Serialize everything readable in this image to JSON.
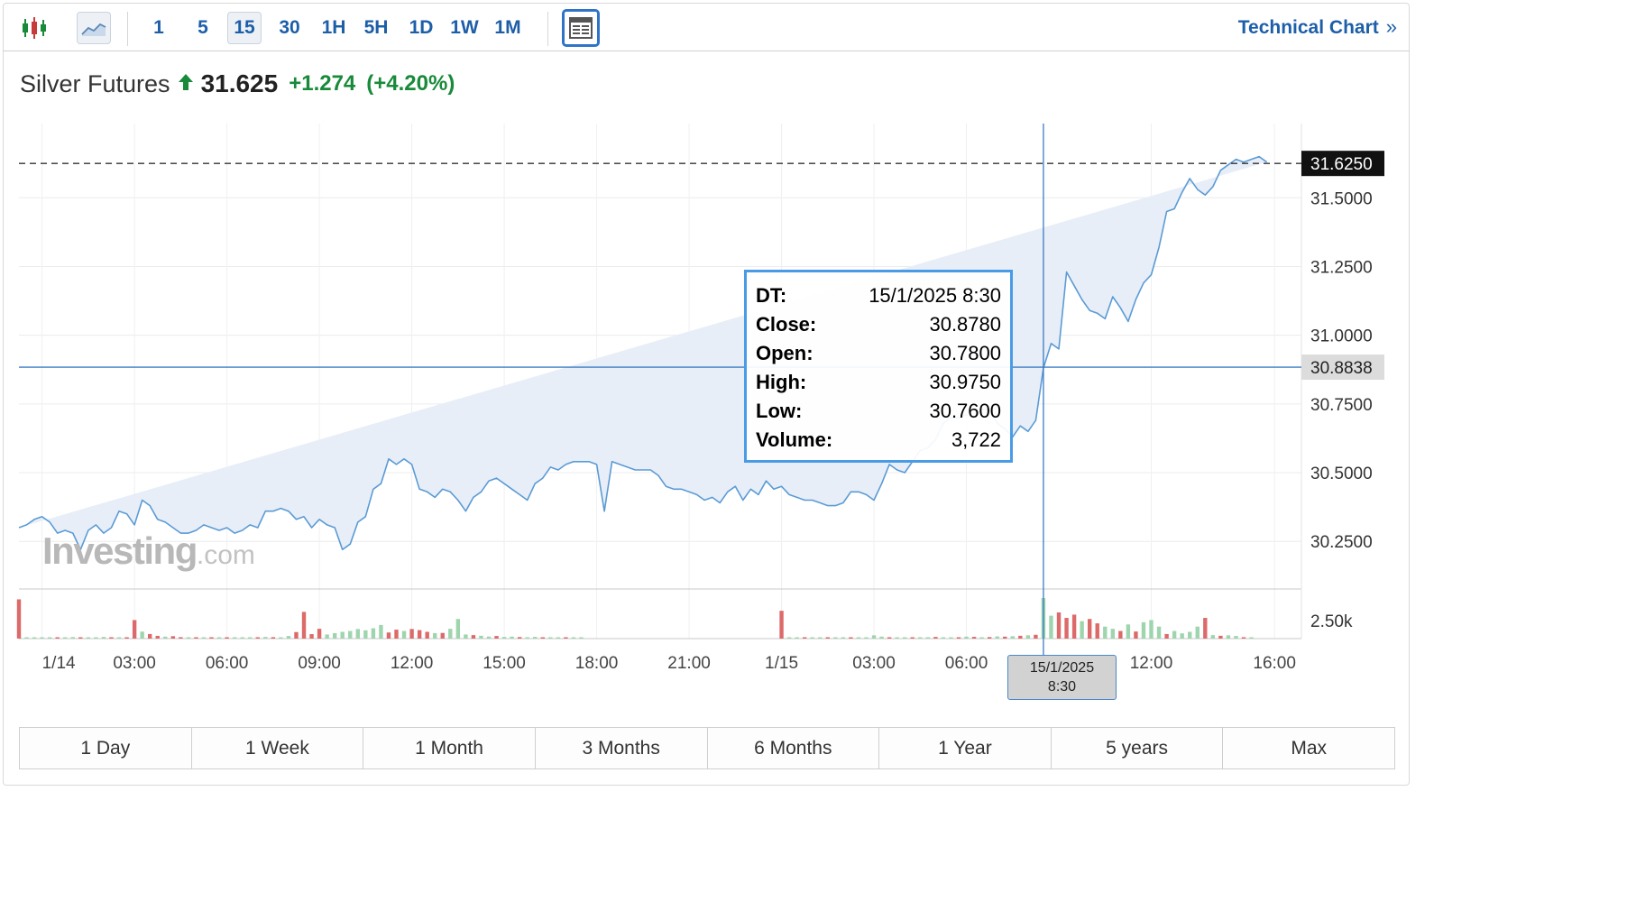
{
  "toolbar": {
    "chart_type_icons": [
      "candlestick-icon",
      "area-chart-icon"
    ],
    "intervals": [
      "1",
      "5",
      "15",
      "30",
      "1H",
      "5H",
      "1D",
      "1W",
      "1M"
    ],
    "selected_interval": "15",
    "layout_icon": "layout-icon",
    "technical_link": "Technical Chart",
    "technical_link_icon": "double-chevron-right-icon"
  },
  "headline": {
    "name": "Silver Futures",
    "price": "31.625",
    "change": "+1.274",
    "change_pct": "(+4.20%)",
    "direction_icon": "arrow-up-icon"
  },
  "colors": {
    "accent": "#1d5ea9",
    "up": "#188a3a",
    "line": "#5b9bd5",
    "area": "#e8eef7",
    "crosshair": "#3a7cc4",
    "volume_up": "#9fd5ae",
    "volume_down": "#dd6a6a",
    "tooltip_border": "#4a9be6"
  },
  "watermark": {
    "brand": "Investing",
    "suffix": ".com"
  },
  "tooltip": [
    {
      "key": "DT:",
      "value": "15/1/2025 8:30"
    },
    {
      "key": "Close:",
      "value": "30.8780"
    },
    {
      "key": "Open:",
      "value": "30.7800"
    },
    {
      "key": "High:",
      "value": "30.9750"
    },
    {
      "key": "Low:",
      "value": "30.7600"
    },
    {
      "key": "Volume:",
      "value": "3,722"
    }
  ],
  "time_flag": {
    "line1": "15/1/2025",
    "line2": "8:30"
  },
  "range_buttons": [
    "1 Day",
    "1 Week",
    "1 Month",
    "3 Months",
    "6 Months",
    "1 Year",
    "5 years",
    "Max"
  ],
  "chart_data": {
    "type": "area",
    "title": "Silver Futures",
    "xlabel": "",
    "ylabel": "",
    "x_ticks": [
      "1/14",
      "03:00",
      "06:00",
      "09:00",
      "12:00",
      "15:00",
      "18:00",
      "21:00",
      "1/15",
      "03:00",
      "06:00",
      "12:00",
      "16:00"
    ],
    "x_ticks_hours": [
      0,
      3,
      6,
      9,
      12,
      15,
      18,
      21,
      24,
      27,
      30,
      36,
      40
    ],
    "y_ticks": [
      "30.2500",
      "30.5000",
      "30.7500",
      "31.0000",
      "31.2500",
      "31.5000"
    ],
    "y_ticks_values": [
      30.25,
      30.5,
      30.75,
      31.0,
      31.25,
      31.5
    ],
    "ylim": [
      30.08,
      31.77
    ],
    "xlim_hours": [
      -0.75,
      40.2
    ],
    "last_price_label": "31.6250",
    "last_price": 31.625,
    "crosshair_label": "30.8838",
    "crosshair_price": 30.8838,
    "crosshair_hour": 32.5,
    "volume_tick_label": "2.50k",
    "volume_tick_value": 2500,
    "grid": true,
    "series": [
      {
        "x": [
          -0.75,
          -0.5,
          -0.25,
          0.0,
          0.25,
          0.5,
          0.75,
          1.0,
          1.25,
          1.5,
          1.75,
          2.0,
          2.25,
          2.5,
          2.75,
          3.0,
          3.25,
          3.5,
          3.75,
          4.0,
          4.25,
          4.5,
          4.75,
          5.0,
          5.25,
          5.5,
          5.75,
          6.0,
          6.25,
          6.5,
          6.75,
          7.0,
          7.25,
          7.5,
          7.75,
          8.0,
          8.25,
          8.5,
          8.75,
          9.0,
          9.25,
          9.5,
          9.75,
          10.0,
          10.25,
          10.5,
          10.75,
          11.0,
          11.25,
          11.5,
          11.75,
          12.0,
          12.25,
          12.5,
          12.75,
          13.0,
          13.25,
          13.5,
          13.75,
          14.0,
          14.25,
          14.5,
          14.75,
          15.0,
          15.25,
          15.5,
          15.75,
          16.0,
          16.25,
          16.5,
          16.75,
          17.0,
          17.25,
          17.5,
          17.75,
          18.0,
          18.25,
          18.5,
          18.75,
          19.0,
          19.25,
          19.5,
          19.75,
          20.0,
          20.25,
          20.5,
          20.75,
          21.0,
          21.25,
          21.5,
          21.75,
          22.0,
          22.25,
          22.5,
          22.75,
          23.0,
          23.25,
          23.5,
          23.75,
          24.0,
          24.25,
          24.5,
          24.75,
          25.0,
          25.25,
          25.5,
          25.75,
          26.0,
          26.25,
          26.5,
          26.75,
          27.0,
          27.25,
          27.5,
          27.75,
          28.0,
          28.25,
          28.5,
          28.75,
          29.0,
          29.25,
          29.5,
          29.75,
          30.0,
          30.25,
          30.5,
          30.75,
          31.0,
          31.25,
          31.5,
          31.75,
          32.0,
          32.25,
          32.5,
          32.75,
          33.0,
          33.25,
          33.5,
          33.75,
          34.0,
          34.25,
          34.5,
          34.75,
          35.0,
          35.25,
          35.5,
          35.75,
          36.0,
          36.25,
          36.5,
          36.75,
          37.0,
          37.25,
          37.5,
          37.75,
          38.0,
          38.25,
          38.5,
          38.75,
          39.0,
          39.25,
          39.5,
          39.75,
          40.0
        ],
        "close": [
          30.3,
          30.31,
          30.33,
          30.34,
          30.32,
          30.28,
          30.29,
          30.28,
          30.22,
          30.29,
          30.31,
          30.28,
          30.3,
          30.36,
          30.35,
          30.31,
          30.4,
          30.38,
          30.33,
          30.32,
          30.3,
          30.28,
          30.28,
          30.29,
          30.31,
          30.3,
          30.29,
          30.3,
          30.28,
          30.29,
          30.31,
          30.3,
          30.36,
          30.36,
          30.37,
          30.36,
          30.33,
          30.34,
          30.3,
          30.33,
          30.31,
          30.3,
          30.22,
          30.24,
          30.32,
          30.34,
          30.44,
          30.46,
          30.55,
          30.53,
          30.55,
          30.53,
          30.44,
          30.43,
          30.41,
          30.44,
          30.43,
          30.4,
          30.36,
          30.41,
          30.43,
          30.47,
          30.48,
          30.46,
          30.44,
          30.42,
          30.4,
          30.46,
          30.48,
          30.52,
          30.51,
          30.53,
          30.54,
          30.54,
          30.54,
          30.53,
          30.36,
          30.54,
          30.53,
          30.52,
          30.51,
          30.51,
          30.51,
          30.49,
          30.45,
          30.44,
          30.44,
          30.43,
          30.42,
          30.4,
          30.41,
          30.39,
          30.43,
          30.45,
          30.4,
          30.44,
          30.42,
          30.47,
          30.44,
          30.45,
          30.42,
          30.41,
          30.4,
          30.4,
          30.39,
          30.38,
          30.38,
          30.39,
          30.43,
          30.43,
          30.42,
          30.4,
          30.46,
          30.53,
          30.51,
          30.5,
          30.54,
          30.58,
          30.59,
          30.62,
          30.68,
          30.7,
          30.7,
          30.71,
          30.7,
          30.73,
          30.73,
          30.68,
          30.66,
          30.63,
          30.67,
          30.65,
          30.69,
          30.88,
          30.97,
          30.95,
          31.23,
          31.18,
          31.13,
          31.09,
          31.08,
          31.06,
          31.14,
          31.1,
          31.05,
          31.13,
          31.19,
          31.22,
          31.32,
          31.45,
          31.46,
          31.52,
          31.57,
          31.53,
          31.51,
          31.54,
          31.6,
          31.62,
          31.64,
          31.63,
          31.64,
          31.65,
          31.63
        ]
      }
    ],
    "volume": [
      {
        "x": -0.75,
        "v": 3600,
        "dir": "down"
      },
      {
        "x": -0.5,
        "v": 100,
        "dir": "up"
      },
      {
        "x": -0.25,
        "v": 80,
        "dir": "up"
      },
      {
        "x": 0.0,
        "v": 120,
        "dir": "up"
      },
      {
        "x": 0.25,
        "v": 60,
        "dir": "up"
      },
      {
        "x": 0.5,
        "v": 90,
        "dir": "down"
      },
      {
        "x": 0.75,
        "v": 70,
        "dir": "up"
      },
      {
        "x": 1.0,
        "v": 140,
        "dir": "up"
      },
      {
        "x": 1.25,
        "v": 60,
        "dir": "down"
      },
      {
        "x": 1.5,
        "v": 120,
        "dir": "up"
      },
      {
        "x": 1.75,
        "v": 80,
        "dir": "up"
      },
      {
        "x": 2.0,
        "v": 150,
        "dir": "up"
      },
      {
        "x": 2.25,
        "v": 60,
        "dir": "down"
      },
      {
        "x": 2.5,
        "v": 90,
        "dir": "up"
      },
      {
        "x": 2.75,
        "v": 70,
        "dir": "down"
      },
      {
        "x": 3.0,
        "v": 1700,
        "dir": "down"
      },
      {
        "x": 3.25,
        "v": 640,
        "dir": "up"
      },
      {
        "x": 3.5,
        "v": 420,
        "dir": "down"
      },
      {
        "x": 3.75,
        "v": 250,
        "dir": "down"
      },
      {
        "x": 4.0,
        "v": 180,
        "dir": "up"
      },
      {
        "x": 4.25,
        "v": 220,
        "dir": "down"
      },
      {
        "x": 4.5,
        "v": 130,
        "dir": "down"
      },
      {
        "x": 4.75,
        "v": 90,
        "dir": "up"
      },
      {
        "x": 5.0,
        "v": 120,
        "dir": "down"
      },
      {
        "x": 5.25,
        "v": 90,
        "dir": "up"
      },
      {
        "x": 5.5,
        "v": 70,
        "dir": "down"
      },
      {
        "x": 5.75,
        "v": 100,
        "dir": "up"
      },
      {
        "x": 6.0,
        "v": 60,
        "dir": "down"
      },
      {
        "x": 6.25,
        "v": 90,
        "dir": "up"
      },
      {
        "x": 6.5,
        "v": 80,
        "dir": "up"
      },
      {
        "x": 6.75,
        "v": 120,
        "dir": "up"
      },
      {
        "x": 7.0,
        "v": 90,
        "dir": "down"
      },
      {
        "x": 7.25,
        "v": 150,
        "dir": "up"
      },
      {
        "x": 7.5,
        "v": 130,
        "dir": "down"
      },
      {
        "x": 7.75,
        "v": 110,
        "dir": "up"
      },
      {
        "x": 8.0,
        "v": 240,
        "dir": "up"
      },
      {
        "x": 8.25,
        "v": 600,
        "dir": "down"
      },
      {
        "x": 8.5,
        "v": 2450,
        "dir": "down"
      },
      {
        "x": 8.75,
        "v": 410,
        "dir": "down"
      },
      {
        "x": 9.0,
        "v": 900,
        "dir": "down"
      },
      {
        "x": 9.25,
        "v": 380,
        "dir": "up"
      },
      {
        "x": 9.5,
        "v": 500,
        "dir": "up"
      },
      {
        "x": 9.75,
        "v": 620,
        "dir": "up"
      },
      {
        "x": 10.0,
        "v": 700,
        "dir": "up"
      },
      {
        "x": 10.25,
        "v": 880,
        "dir": "up"
      },
      {
        "x": 10.5,
        "v": 760,
        "dir": "up"
      },
      {
        "x": 10.75,
        "v": 950,
        "dir": "up"
      },
      {
        "x": 11.0,
        "v": 1250,
        "dir": "up"
      },
      {
        "x": 11.25,
        "v": 560,
        "dir": "down"
      },
      {
        "x": 11.5,
        "v": 820,
        "dir": "down"
      },
      {
        "x": 11.75,
        "v": 700,
        "dir": "up"
      },
      {
        "x": 12.0,
        "v": 880,
        "dir": "down"
      },
      {
        "x": 12.25,
        "v": 780,
        "dir": "down"
      },
      {
        "x": 12.5,
        "v": 620,
        "dir": "down"
      },
      {
        "x": 12.75,
        "v": 500,
        "dir": "up"
      },
      {
        "x": 13.0,
        "v": 520,
        "dir": "down"
      },
      {
        "x": 13.25,
        "v": 900,
        "dir": "up"
      },
      {
        "x": 13.5,
        "v": 1800,
        "dir": "up"
      },
      {
        "x": 13.75,
        "v": 380,
        "dir": "up"
      },
      {
        "x": 14.0,
        "v": 320,
        "dir": "down"
      },
      {
        "x": 14.25,
        "v": 260,
        "dir": "up"
      },
      {
        "x": 14.5,
        "v": 190,
        "dir": "up"
      },
      {
        "x": 14.75,
        "v": 240,
        "dir": "down"
      },
      {
        "x": 15.0,
        "v": 150,
        "dir": "up"
      },
      {
        "x": 15.25,
        "v": 180,
        "dir": "up"
      },
      {
        "x": 15.5,
        "v": 140,
        "dir": "down"
      },
      {
        "x": 15.75,
        "v": 120,
        "dir": "up"
      },
      {
        "x": 16.0,
        "v": 160,
        "dir": "up"
      },
      {
        "x": 16.25,
        "v": 110,
        "dir": "down"
      },
      {
        "x": 16.5,
        "v": 90,
        "dir": "up"
      },
      {
        "x": 16.75,
        "v": 100,
        "dir": "up"
      },
      {
        "x": 17.0,
        "v": 70,
        "dir": "down"
      },
      {
        "x": 17.25,
        "v": 80,
        "dir": "up"
      },
      {
        "x": 17.5,
        "v": 60,
        "dir": "up"
      },
      {
        "x": 24.0,
        "v": 2550,
        "dir": "down"
      },
      {
        "x": 24.25,
        "v": 120,
        "dir": "up"
      },
      {
        "x": 24.5,
        "v": 90,
        "dir": "up"
      },
      {
        "x": 24.75,
        "v": 80,
        "dir": "down"
      },
      {
        "x": 25.0,
        "v": 100,
        "dir": "up"
      },
      {
        "x": 25.25,
        "v": 70,
        "dir": "up"
      },
      {
        "x": 25.5,
        "v": 60,
        "dir": "down"
      },
      {
        "x": 25.75,
        "v": 90,
        "dir": "up"
      },
      {
        "x": 26.0,
        "v": 120,
        "dir": "up"
      },
      {
        "x": 26.25,
        "v": 80,
        "dir": "down"
      },
      {
        "x": 26.5,
        "v": 70,
        "dir": "up"
      },
      {
        "x": 26.75,
        "v": 120,
        "dir": "up"
      },
      {
        "x": 27.0,
        "v": 300,
        "dir": "up"
      },
      {
        "x": 27.25,
        "v": 180,
        "dir": "up"
      },
      {
        "x": 27.5,
        "v": 120,
        "dir": "down"
      },
      {
        "x": 27.75,
        "v": 90,
        "dir": "up"
      },
      {
        "x": 28.0,
        "v": 100,
        "dir": "up"
      },
      {
        "x": 28.25,
        "v": 70,
        "dir": "down"
      },
      {
        "x": 28.5,
        "v": 90,
        "dir": "up"
      },
      {
        "x": 28.75,
        "v": 80,
        "dir": "up"
      },
      {
        "x": 29.0,
        "v": 150,
        "dir": "down"
      },
      {
        "x": 29.25,
        "v": 90,
        "dir": "up"
      },
      {
        "x": 29.5,
        "v": 110,
        "dir": "up"
      },
      {
        "x": 29.75,
        "v": 100,
        "dir": "down"
      },
      {
        "x": 30.0,
        "v": 180,
        "dir": "up"
      },
      {
        "x": 30.25,
        "v": 160,
        "dir": "down"
      },
      {
        "x": 30.5,
        "v": 120,
        "dir": "up"
      },
      {
        "x": 30.75,
        "v": 140,
        "dir": "down"
      },
      {
        "x": 31.0,
        "v": 200,
        "dir": "up"
      },
      {
        "x": 31.25,
        "v": 180,
        "dir": "down"
      },
      {
        "x": 31.5,
        "v": 220,
        "dir": "up"
      },
      {
        "x": 31.75,
        "v": 260,
        "dir": "down"
      },
      {
        "x": 32.0,
        "v": 300,
        "dir": "up"
      },
      {
        "x": 32.25,
        "v": 350,
        "dir": "down"
      },
      {
        "x": 32.5,
        "v": 3722,
        "dir": "up"
      },
      {
        "x": 32.75,
        "v": 2100,
        "dir": "up"
      },
      {
        "x": 33.0,
        "v": 2400,
        "dir": "down"
      },
      {
        "x": 33.25,
        "v": 1900,
        "dir": "down"
      },
      {
        "x": 33.5,
        "v": 2200,
        "dir": "down"
      },
      {
        "x": 33.75,
        "v": 1600,
        "dir": "up"
      },
      {
        "x": 34.0,
        "v": 1800,
        "dir": "down"
      },
      {
        "x": 34.25,
        "v": 1400,
        "dir": "down"
      },
      {
        "x": 34.5,
        "v": 1100,
        "dir": "up"
      },
      {
        "x": 34.75,
        "v": 900,
        "dir": "up"
      },
      {
        "x": 35.0,
        "v": 700,
        "dir": "down"
      },
      {
        "x": 35.25,
        "v": 1300,
        "dir": "up"
      },
      {
        "x": 35.5,
        "v": 650,
        "dir": "down"
      },
      {
        "x": 35.75,
        "v": 1500,
        "dir": "up"
      },
      {
        "x": 36.0,
        "v": 1700,
        "dir": "up"
      },
      {
        "x": 36.25,
        "v": 1100,
        "dir": "up"
      },
      {
        "x": 36.5,
        "v": 420,
        "dir": "down"
      },
      {
        "x": 36.75,
        "v": 700,
        "dir": "up"
      },
      {
        "x": 37.0,
        "v": 480,
        "dir": "up"
      },
      {
        "x": 37.25,
        "v": 620,
        "dir": "up"
      },
      {
        "x": 37.5,
        "v": 1100,
        "dir": "up"
      },
      {
        "x": 37.75,
        "v": 1900,
        "dir": "down"
      },
      {
        "x": 38.0,
        "v": 320,
        "dir": "up"
      },
      {
        "x": 38.25,
        "v": 260,
        "dir": "down"
      },
      {
        "x": 38.5,
        "v": 300,
        "dir": "up"
      },
      {
        "x": 38.75,
        "v": 240,
        "dir": "up"
      },
      {
        "x": 39.0,
        "v": 120,
        "dir": "down"
      },
      {
        "x": 39.25,
        "v": 90,
        "dir": "up"
      }
    ]
  }
}
